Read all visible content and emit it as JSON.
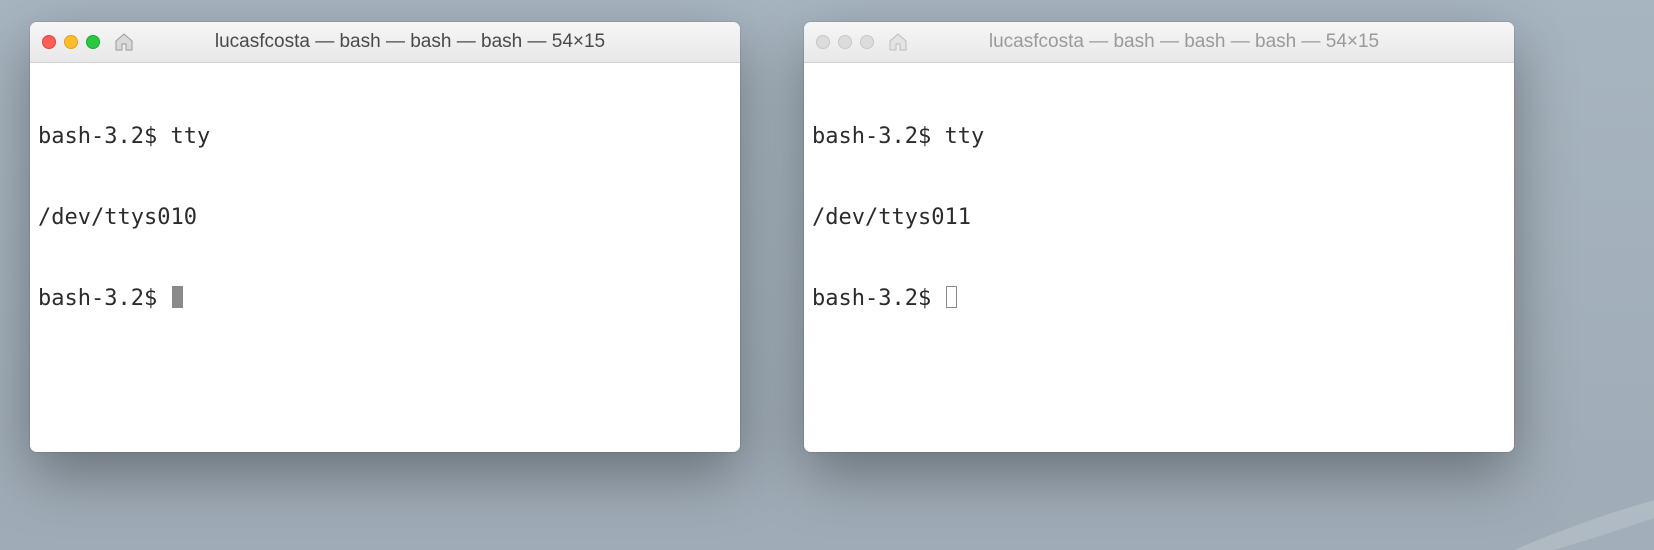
{
  "windows": [
    {
      "id": "left",
      "active": true,
      "title": "lucasfcosta — bash — bash — bash — 54×15",
      "lines": [
        "bash-3.2$ tty",
        "/dev/ttys010",
        "bash-3.2$ "
      ],
      "cursor": "filled"
    },
    {
      "id": "right",
      "active": false,
      "title": "lucasfcosta — bash — bash — bash — 54×15",
      "lines": [
        "bash-3.2$ tty",
        "/dev/ttys011",
        "bash-3.2$ "
      ],
      "cursor": "hollow"
    }
  ]
}
